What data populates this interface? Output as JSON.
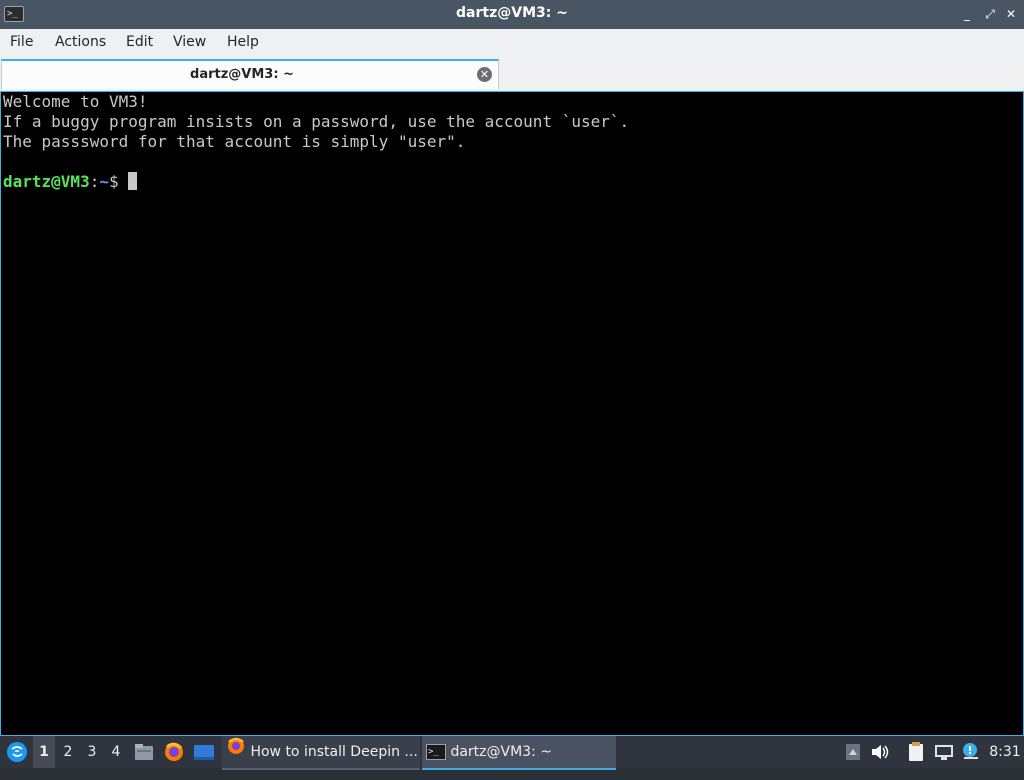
{
  "window": {
    "title": "dartz@VM3: ~",
    "app_icon_text": ">_",
    "buttons": {
      "minimize": "_",
      "maximize": "⤢",
      "close": "✕"
    }
  },
  "menu": {
    "items": [
      "File",
      "Actions",
      "Edit",
      "View",
      "Help"
    ]
  },
  "tabs": [
    {
      "label": "dartz@VM3: ~",
      "close": "✕"
    }
  ],
  "terminal": {
    "lines": [
      "Welcome to VM3!",
      "If a buggy program insists on a password, use the account `user`.",
      "The passsword for that account is simply \"user\"."
    ],
    "prompt": {
      "user_host": "dartz@VM3",
      "separator": ":",
      "path": "~",
      "symbol": "$"
    }
  },
  "taskbar": {
    "workspaces": [
      "1",
      "2",
      "3",
      "4"
    ],
    "active_workspace": "1",
    "tasks": [
      {
        "label": "How to install Deepin ...",
        "icon": "firefox-icon"
      },
      {
        "label": "dartz@VM3: ~",
        "icon": "terminal-icon"
      }
    ],
    "launchers": [
      "file-manager-icon",
      "firefox-icon",
      "desktop-icon"
    ],
    "clock": "8:31"
  },
  "colors": {
    "accent": "#3daee9",
    "titlebar": "#4a5563",
    "terminal_bg": "#000000",
    "prompt_user": "#54e35a",
    "prompt_path": "#6b8fff",
    "taskbar": "#2f343f"
  }
}
